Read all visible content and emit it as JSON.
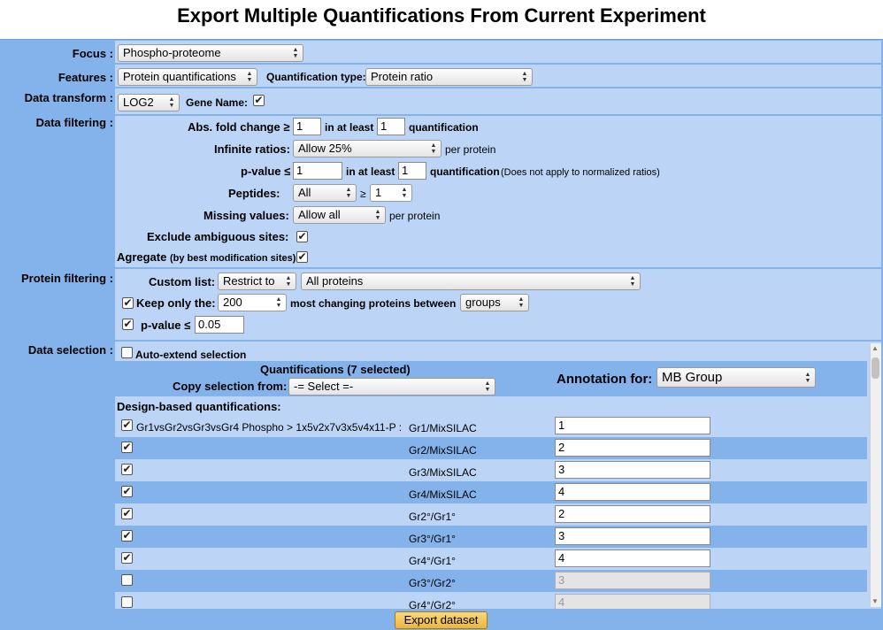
{
  "title": "Export Multiple Quantifications From Current Experiment",
  "focus": {
    "label": "Focus :",
    "value": "Phospho-proteome"
  },
  "features": {
    "label": "Features :",
    "value": "Protein quantifications",
    "quant_type_label": "Quantification type:",
    "quant_type_value": "Protein ratio"
  },
  "data_transform": {
    "label": "Data transform :",
    "value": "LOG2",
    "gene_name_label": "Gene Name:",
    "gene_name_checked": true
  },
  "data_filtering": {
    "label": "Data filtering :",
    "abs_fold_label": "Abs. fold change ≥",
    "abs_fold_value": "1",
    "in_at_least_1": "in at least",
    "abs_fold_count": "1",
    "quantification_1": "quantification",
    "infinite_label": "Infinite ratios:",
    "infinite_value": "Allow 25%",
    "per_protein_1": "per protein",
    "pvalue_label": "p-value ≤",
    "pvalue_value": "1",
    "in_at_least_2": "in at least",
    "pvalue_count": "1",
    "quantification_2": "quantification",
    "pvalue_note": "(Does not apply to normalized ratios)",
    "peptides_label": "Peptides:",
    "peptides_value": "All",
    "ge": "≥",
    "peptides_min": "1",
    "missing_label": "Missing values:",
    "missing_value": "Allow all",
    "per_protein_2": "per protein",
    "exclude_label": "Exclude ambiguous sites:",
    "exclude_checked": true,
    "agregate_label": "Agregate",
    "agregate_note": "(by best modification sites)",
    "agregate_colon": ":",
    "agregate_checked": true
  },
  "protein_filtering": {
    "label": "Protein filtering :",
    "custom_list_label": "Custom list:",
    "restrict_value": "Restrict to",
    "list_value": "All proteins",
    "keep_label": "Keep only the:",
    "keep_value": "200",
    "most_changing_label": "most changing proteins between",
    "between_value": "groups",
    "pvalue_label": "p-value ≤",
    "pvalue_value": "0.05"
  },
  "data_selection": {
    "label": "Data selection :",
    "auto_extend_label": "Auto-extend selection",
    "quant_header": "Quantifications (7 selected)",
    "copy_label": "Copy selection from:",
    "copy_value": "-= Select =-",
    "annotation_label": "Annotation for:",
    "annotation_value": "MB Group",
    "design_header": "Design-based quantifications:",
    "rows": [
      {
        "prefix": "Gr1vsGr2vsGr3vsGr4 Phospho > 1x5v2x7v3x5v4x11-P : ",
        "name": "Gr1/MixSILAC",
        "value": "1",
        "checked": true,
        "disabled": false
      },
      {
        "prefix": "",
        "name": "Gr2/MixSILAC",
        "value": "2",
        "checked": true,
        "disabled": false
      },
      {
        "prefix": "",
        "name": "Gr3/MixSILAC",
        "value": "3",
        "checked": true,
        "disabled": false
      },
      {
        "prefix": "",
        "name": "Gr4/MixSILAC",
        "value": "4",
        "checked": true,
        "disabled": false
      },
      {
        "prefix": "",
        "name": "Gr2°/Gr1°",
        "value": "2",
        "checked": true,
        "disabled": false
      },
      {
        "prefix": "",
        "name": "Gr3°/Gr1°",
        "value": "3",
        "checked": true,
        "disabled": false
      },
      {
        "prefix": "",
        "name": "Gr4°/Gr1°",
        "value": "4",
        "checked": true,
        "disabled": false
      },
      {
        "prefix": "",
        "name": "Gr3°/Gr2°",
        "value": "3",
        "checked": false,
        "disabled": true
      },
      {
        "prefix": "",
        "name": "Gr4°/Gr2°",
        "value": "4",
        "checked": false,
        "disabled": true
      }
    ]
  },
  "export_button": "Export dataset",
  "colors": {
    "frame": "#84b2ea",
    "cell": "#bcd5f6",
    "row_alt": "#84b2ea"
  }
}
